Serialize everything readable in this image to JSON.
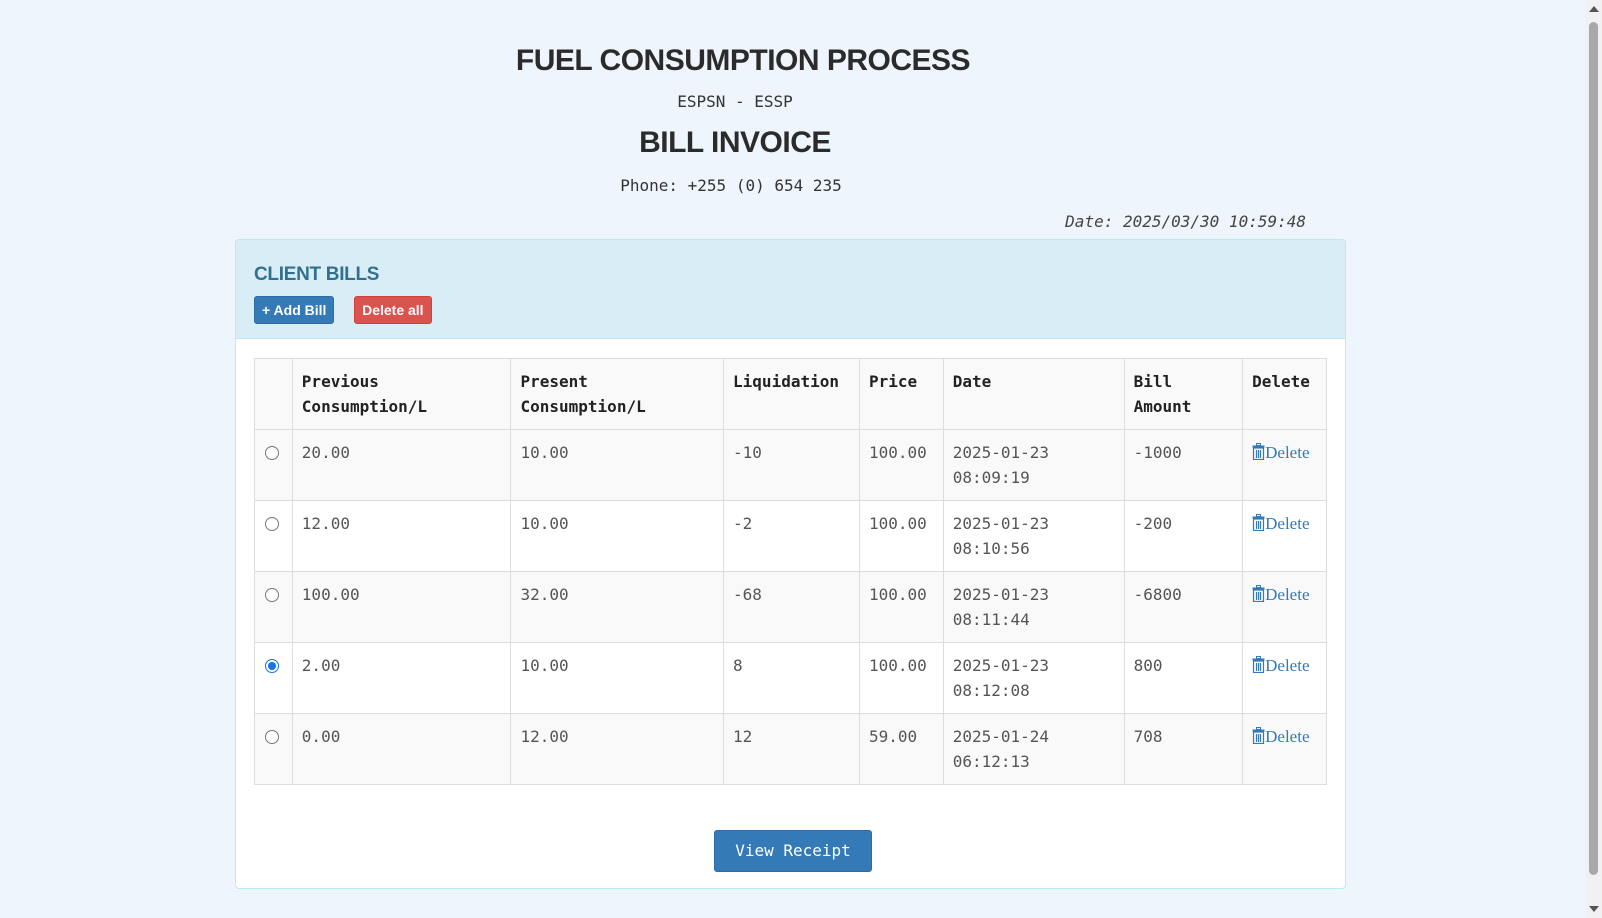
{
  "header": {
    "title": "FUEL CONSUMPTION PROCESS",
    "subtitle": "ESPSN - ESSP",
    "invoice_title": "BILL INVOICE",
    "phone": "Phone: +255 (0) 654 235",
    "date": "Date: 2025/03/30 10:59:48"
  },
  "panel": {
    "title": "CLIENT BILLS",
    "add_bill_label": "+ Add Bill",
    "delete_all_label": "Delete all"
  },
  "table": {
    "columns": [
      "",
      "Previous Consumption/L",
      "Present Consumption/L",
      "Liquidation",
      "Price",
      "Date",
      "Bill Amount",
      "Delete"
    ],
    "rows": [
      {
        "selected": false,
        "previous": "20.00",
        "present": "10.00",
        "liquidation": "-10",
        "price": "100.00",
        "date_day": "2025-01-23",
        "date_time": "08:09:19",
        "amount": "-1000",
        "delete_label": "Delete"
      },
      {
        "selected": false,
        "previous": "12.00",
        "present": "10.00",
        "liquidation": "-2",
        "price": "100.00",
        "date_day": "2025-01-23",
        "date_time": "08:10:56",
        "amount": "-200",
        "delete_label": "Delete"
      },
      {
        "selected": false,
        "previous": "100.00",
        "present": "32.00",
        "liquidation": "-68",
        "price": "100.00",
        "date_day": "2025-01-23",
        "date_time": "08:11:44",
        "amount": "-6800",
        "delete_label": "Delete"
      },
      {
        "selected": true,
        "previous": "2.00",
        "present": "10.00",
        "liquidation": "8",
        "price": "100.00",
        "date_day": "2025-01-23",
        "date_time": "08:12:08",
        "amount": "800",
        "delete_label": "Delete"
      },
      {
        "selected": false,
        "previous": "0.00",
        "present": "12.00",
        "liquidation": "12",
        "price": "59.00",
        "date_day": "2025-01-24",
        "date_time": "06:12:13",
        "amount": "708",
        "delete_label": "Delete"
      }
    ]
  },
  "footer": {
    "view_receipt_label": "View Receipt"
  },
  "colors": {
    "primary": "#337ab7",
    "danger": "#d9534f",
    "panel_heading_bg": "#d9edf7",
    "page_bg": "#eef5fd"
  }
}
